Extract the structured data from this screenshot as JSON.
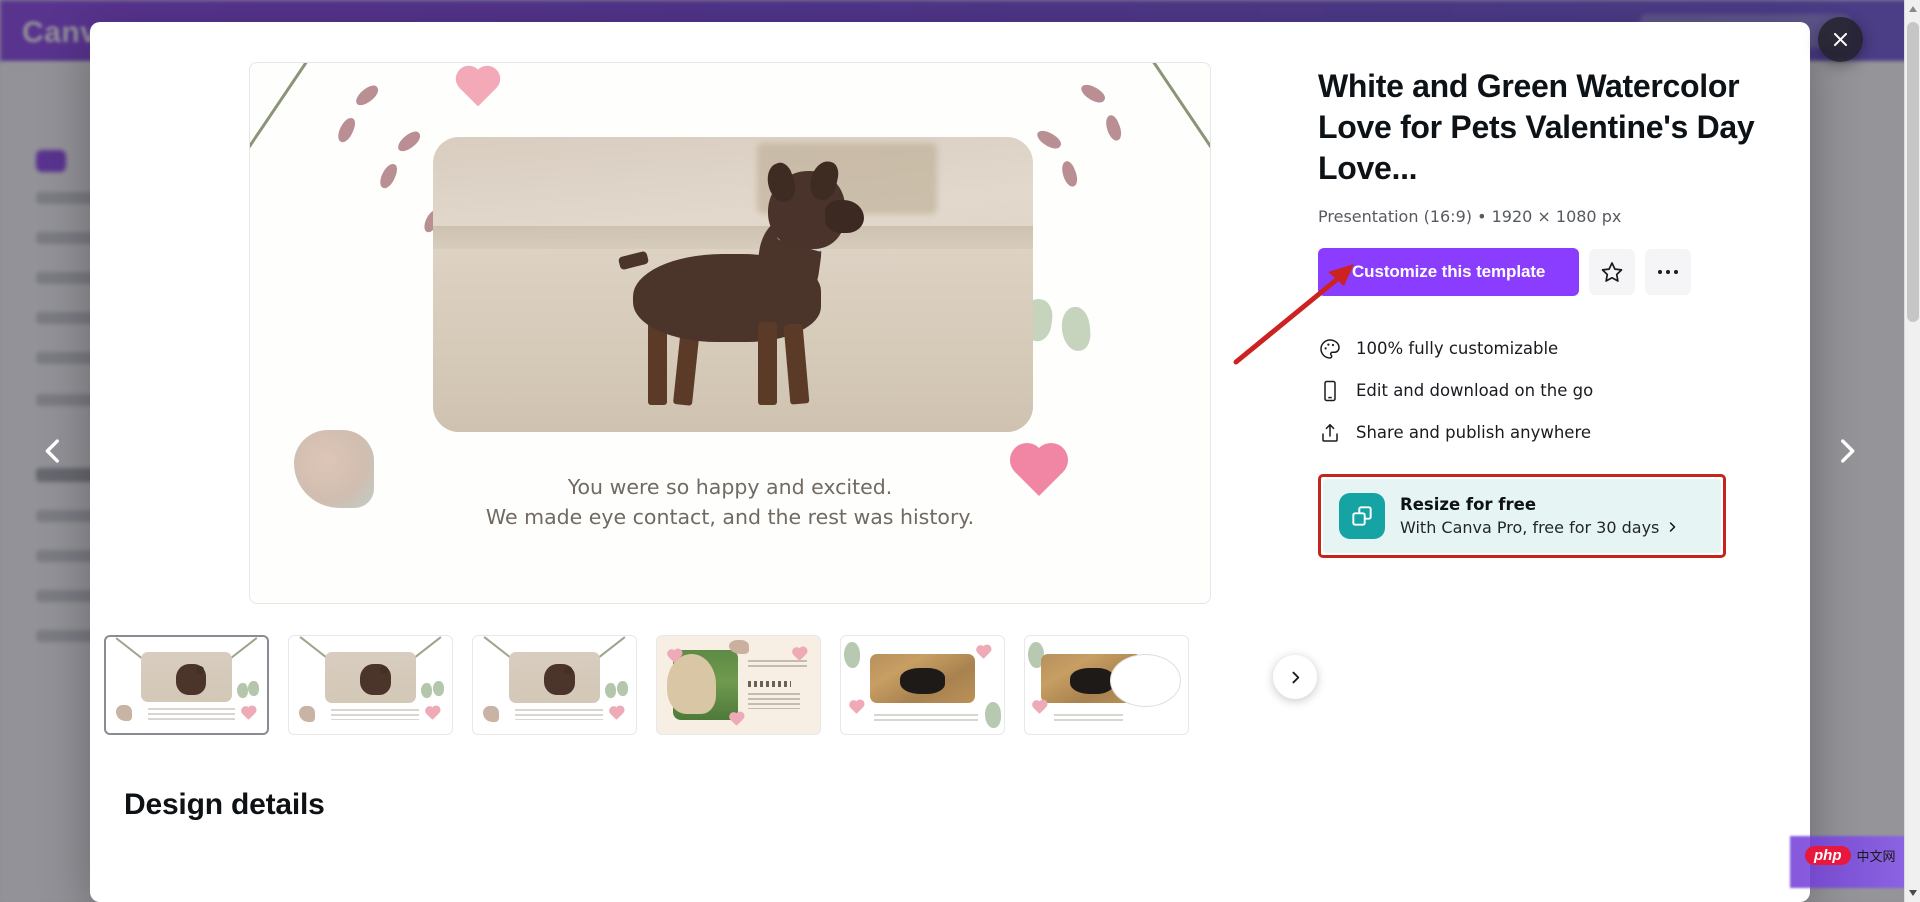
{
  "modal": {
    "close_label": "Close",
    "prev_label": "Previous template",
    "next_label": "Next template"
  },
  "template": {
    "title": "White and Green Watercolor Love for Pets Valentine's Day Love...",
    "meta": "Presentation (16:9) • 1920 × 1080 px",
    "customize_label": "Customize this template",
    "favorite_label": "Add to favorites",
    "more_label": "More options"
  },
  "features": [
    {
      "icon": "palette-icon",
      "label": "100% fully customizable"
    },
    {
      "icon": "mobile-icon",
      "label": "Edit and download on the go"
    },
    {
      "icon": "share-icon",
      "label": "Share and publish anywhere"
    }
  ],
  "resize_promo": {
    "icon": "resize-icon",
    "title": "Resize for free",
    "subtitle": "With Canva Pro, free for 30 days",
    "chevron": "chevron-right-icon",
    "highlight_color": "#c4261d",
    "background_color": "#e6f5f3",
    "icon_color": "#16a3a3"
  },
  "preview": {
    "caption_line1": "You were so happy and excited.",
    "caption_line2": "We made eye contact, and the rest was history.",
    "thumbnails": [
      {
        "index": "1",
        "variant": "dog-beach",
        "selected": true
      },
      {
        "index": "2",
        "variant": "dog-beach",
        "selected": false
      },
      {
        "index": "3",
        "variant": "dog-beach",
        "selected": false
      },
      {
        "index": "4",
        "variant": "woman-dog-grass",
        "selected": false
      },
      {
        "index": "5",
        "variant": "dog-straw",
        "selected": false
      },
      {
        "index": "6",
        "variant": "dog-straw-bubble",
        "selected": false
      }
    ],
    "thumb_next_label": "Show more pages"
  },
  "design_details": {
    "heading": "Design details"
  },
  "watermark": {
    "php": "php",
    "cn": "中文网"
  },
  "colors": {
    "brand_purple": "#8b3dff",
    "teal": "#16a3a3",
    "annotation_red": "#c4261d"
  }
}
